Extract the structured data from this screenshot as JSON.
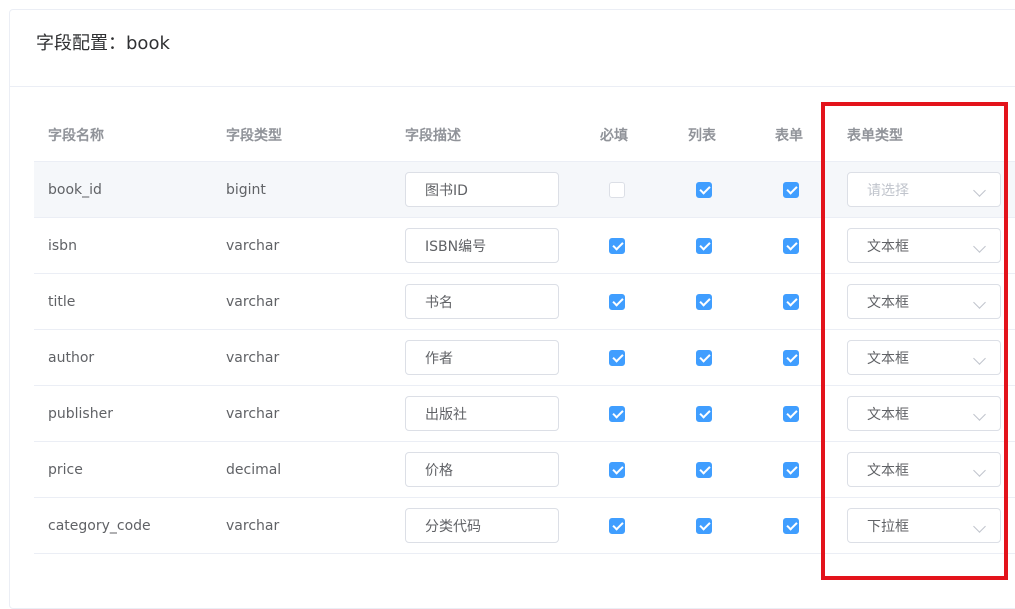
{
  "card": {
    "title": "字段配置：book"
  },
  "table": {
    "headers": {
      "name": "字段名称",
      "type": "字段类型",
      "desc": "字段描述",
      "required": "必填",
      "list": "列表",
      "form": "表单",
      "form_type": "表单类型"
    },
    "rows": [
      {
        "name": "book_id",
        "type": "bigint",
        "desc": "图书ID",
        "required": false,
        "list": true,
        "form": true,
        "form_type": "请选择",
        "form_type_placeholder": true
      },
      {
        "name": "isbn",
        "type": "varchar",
        "desc": "ISBN编号",
        "required": true,
        "list": true,
        "form": true,
        "form_type": "文本框",
        "form_type_placeholder": false
      },
      {
        "name": "title",
        "type": "varchar",
        "desc": "书名",
        "required": true,
        "list": true,
        "form": true,
        "form_type": "文本框",
        "form_type_placeholder": false
      },
      {
        "name": "author",
        "type": "varchar",
        "desc": "作者",
        "required": true,
        "list": true,
        "form": true,
        "form_type": "文本框",
        "form_type_placeholder": false
      },
      {
        "name": "publisher",
        "type": "varchar",
        "desc": "出版社",
        "required": true,
        "list": true,
        "form": true,
        "form_type": "文本框",
        "form_type_placeholder": false
      },
      {
        "name": "price",
        "type": "decimal",
        "desc": "价格",
        "required": true,
        "list": true,
        "form": true,
        "form_type": "文本框",
        "form_type_placeholder": false
      },
      {
        "name": "category_code",
        "type": "varchar",
        "desc": "分类代码",
        "required": true,
        "list": true,
        "form": true,
        "form_type": "下拉框",
        "form_type_placeholder": false
      }
    ]
  },
  "colors": {
    "accent": "#409eff",
    "highlight_border": "#e3131b",
    "hover_row": "#f5f7fa"
  }
}
